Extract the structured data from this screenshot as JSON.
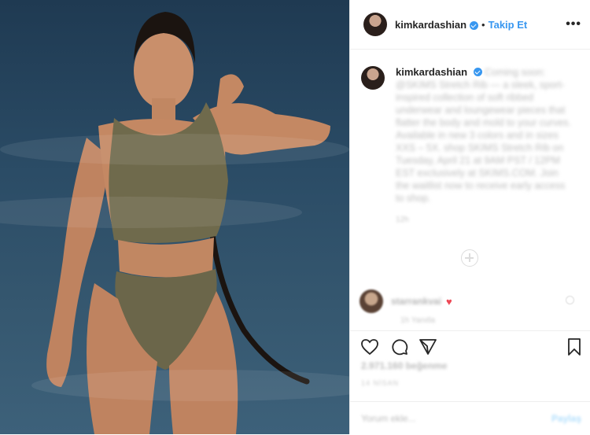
{
  "header": {
    "username": "kimkardashian",
    "follow_label": "Takip Et",
    "more_label": "•••"
  },
  "caption": {
    "username": "kimkardashian",
    "text": "Coming soon: @SKIMS Stretch Rib — a sleek, sport-inspired collection of soft ribbed underwear and loungewear pieces that flatter the body and mold to your curves. Available in new 3 colors and in sizes XXS – 5X. shop SKIMS Stretch Rib on Tuesday, April 21 at 9AM PST / 12PM EST exclusively at SKIMS.COM. Join the waitlist now to receive early access to shop.",
    "time": "12h"
  },
  "comment": {
    "username": "starrankvai",
    "meta": "1h   Yanıtla"
  },
  "stats": {
    "likes": "2.971.160 beğenme",
    "date": "14 NİSAN"
  },
  "add_comment": {
    "placeholder": "Yorum ekle...",
    "post_label": "Paylaş"
  },
  "colors": {
    "accent": "#3897f0",
    "heart": "#ed4956",
    "border": "#efefef"
  },
  "icons": [
    "heart-icon",
    "comment-icon",
    "share-icon",
    "bookmark-icon",
    "verified-icon",
    "add-comments-icon"
  ]
}
